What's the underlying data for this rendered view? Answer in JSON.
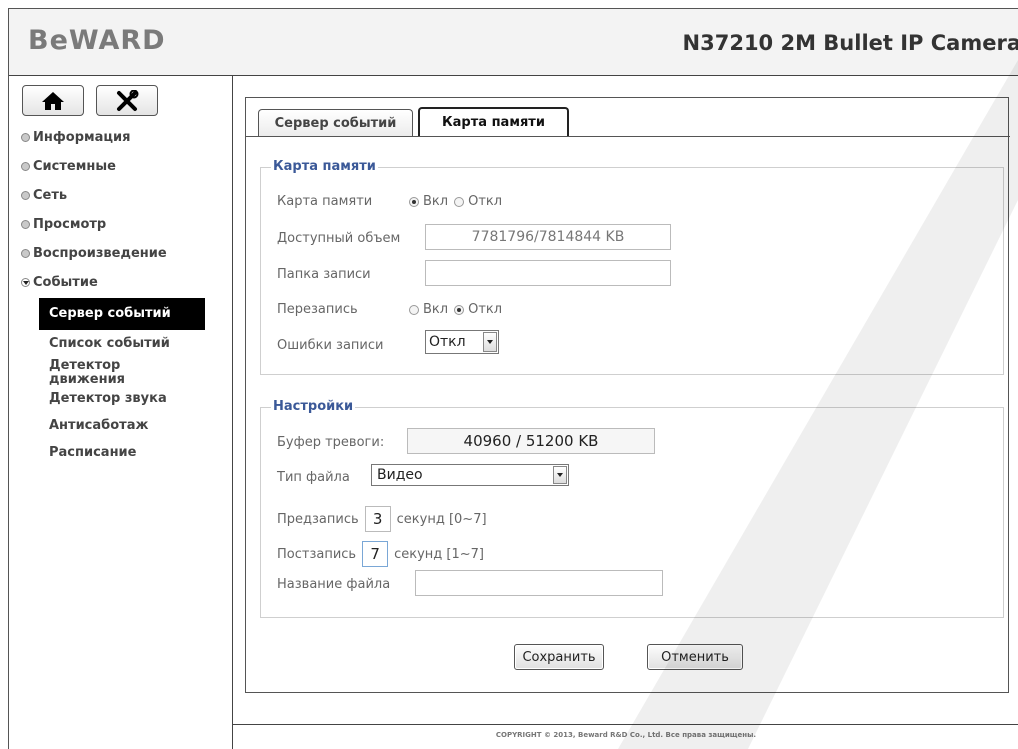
{
  "header": {
    "logo": "BeWARD",
    "camera_title": "N37210 2M Bullet IP Camera"
  },
  "sidebar": {
    "icons": [
      "home-icon",
      "tools-icon"
    ],
    "items": [
      {
        "label": "Информация"
      },
      {
        "label": "Системные"
      },
      {
        "label": "Сеть"
      },
      {
        "label": "Просмотр"
      },
      {
        "label": "Воспроизведение"
      },
      {
        "label": "Событие"
      }
    ],
    "sub_items": [
      {
        "label": "Сервер событий",
        "active": true
      },
      {
        "label": "Список событий"
      },
      {
        "label": "Детектор движения"
      },
      {
        "label": "Детектор звука"
      },
      {
        "label": "Антисаботаж"
      },
      {
        "label": "Расписание"
      }
    ]
  },
  "tabs": [
    {
      "label": "Сервер событий",
      "active": false
    },
    {
      "label": "Карта памяти",
      "active": true
    }
  ],
  "memory_card": {
    "legend": "Карта памяти",
    "card_label": "Карта памяти",
    "on_label": "Вкл",
    "off_label": "Откл",
    "card_state": "Вкл",
    "capacity_label": "Доступный объем",
    "capacity_value": "7781796/7814844 KB",
    "folder_label": "Папка записи",
    "folder_value": "",
    "overwrite_label": "Перезапись",
    "overwrite_state": "Откл",
    "errors_label": "Ошибки записи",
    "errors_value": "Откл"
  },
  "settings": {
    "legend": "Настройки",
    "alarm_buffer_label": "Буфер тревоги:",
    "alarm_buffer_value": "40960 / 51200 KB",
    "file_type_label": "Тип файла",
    "file_type_value": "Видео",
    "pre_record_label": "Предзапись",
    "pre_record_value": "3",
    "pre_record_range": "секунд [0~7]",
    "post_record_label": "Постзапись",
    "post_record_value": "7",
    "post_record_range": "секунд [1~7]",
    "file_name_label": "Название файла",
    "file_name_value": ""
  },
  "actions": {
    "save_label": "Сохранить",
    "cancel_label": "Отменить"
  },
  "footer": {
    "copyright": "COPYRIGHT © 2013, Beward R&D Co., Ltd. Все права защищены."
  },
  "colors": {
    "legend": "#3b5998",
    "active_item_bg": "#000000"
  }
}
